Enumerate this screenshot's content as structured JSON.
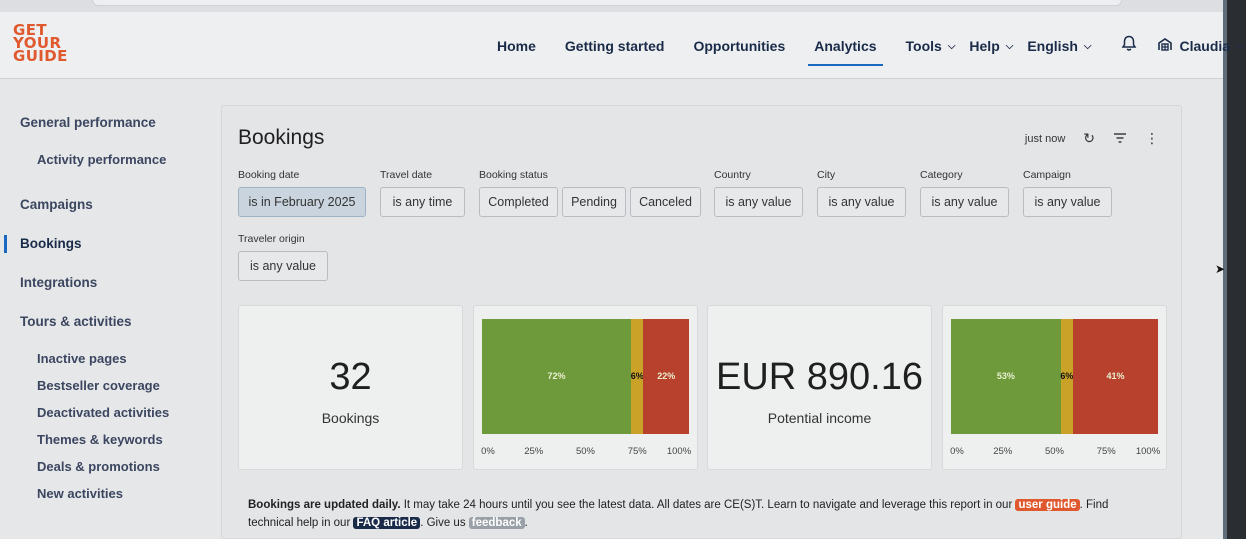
{
  "logo": {
    "lines": [
      "GET",
      "YOUR",
      "GUIDE"
    ],
    "color": "#e0582d"
  },
  "nav": {
    "items": [
      {
        "label": "Home"
      },
      {
        "label": "Getting started"
      },
      {
        "label": "Opportunities"
      },
      {
        "label": "Analytics",
        "active": true
      },
      {
        "label": "Tools",
        "dropdown": true
      },
      {
        "label": "Help",
        "dropdown": true
      },
      {
        "label": "English",
        "dropdown": true
      }
    ],
    "bell_icon": "bell-icon",
    "user": {
      "name": "Claudia",
      "icon": "account-icon"
    }
  },
  "sidebar": {
    "items": [
      {
        "label": "General performance"
      },
      {
        "label": "Activity performance"
      },
      {
        "label": "Campaigns"
      },
      {
        "label": "Bookings",
        "active": true
      },
      {
        "label": "Integrations"
      },
      {
        "label": "Tours & activities"
      },
      {
        "label": "Inactive pages"
      },
      {
        "label": "Bestseller coverage"
      },
      {
        "label": "Deactivated activities"
      },
      {
        "label": "Themes & keywords"
      },
      {
        "label": "Deals & promotions"
      },
      {
        "label": "New activities"
      }
    ]
  },
  "report": {
    "title": "Bookings",
    "refreshed": "just now",
    "filters": {
      "booking_date": {
        "label": "Booking date",
        "value": "is in February 2025"
      },
      "travel_date": {
        "label": "Travel date",
        "value": "is any time"
      },
      "booking_status": {
        "label": "Booking status",
        "values": [
          "Completed",
          "Pending",
          "Canceled"
        ]
      },
      "country": {
        "label": "Country",
        "value": "is any value"
      },
      "city": {
        "label": "City",
        "value": "is any value"
      },
      "category": {
        "label": "Category",
        "value": "is any value"
      },
      "campaign": {
        "label": "Campaign",
        "value": "is any value"
      },
      "traveler_origin": {
        "label": "Traveler origin",
        "value": "is any value"
      }
    },
    "kpis": [
      {
        "value": "32",
        "label": "Bookings"
      },
      {
        "value": "EUR 890.16",
        "label": "Potential income"
      }
    ],
    "note": {
      "bold": "Bookings are updated daily.",
      "text1": " It may take 24 hours until you see the latest data. All dates are CE(S)T. Learn to navigate and leverage this report in our ",
      "link1": "user guide",
      "text2": ". Find technical help in our ",
      "link2": "FAQ article",
      "text3": ". Give us ",
      "link3": "feedback",
      "text4": "."
    }
  },
  "chart_data": [
    {
      "type": "bar",
      "orientation": "horizontal-stacked-100",
      "series": [
        {
          "value": 72,
          "label": "72%",
          "color": "#6f9a3b"
        },
        {
          "value": 6,
          "label": "6%",
          "color": "#c9a227"
        },
        {
          "value": 22,
          "label": "22%",
          "color": "#b8412d"
        }
      ],
      "xticks": [
        "0%",
        "25%",
        "50%",
        "75%",
        "100%"
      ],
      "xlim": [
        0,
        100
      ]
    },
    {
      "type": "bar",
      "orientation": "horizontal-stacked-100",
      "series": [
        {
          "value": 53,
          "label": "53%",
          "color": "#6f9a3b"
        },
        {
          "value": 6,
          "label": "6%",
          "color": "#c9a227"
        },
        {
          "value": 41,
          "label": "41%",
          "color": "#b8412d"
        }
      ],
      "xticks": [
        "0%",
        "25%",
        "50%",
        "75%",
        "100%"
      ],
      "xlim": [
        0,
        100
      ]
    }
  ]
}
